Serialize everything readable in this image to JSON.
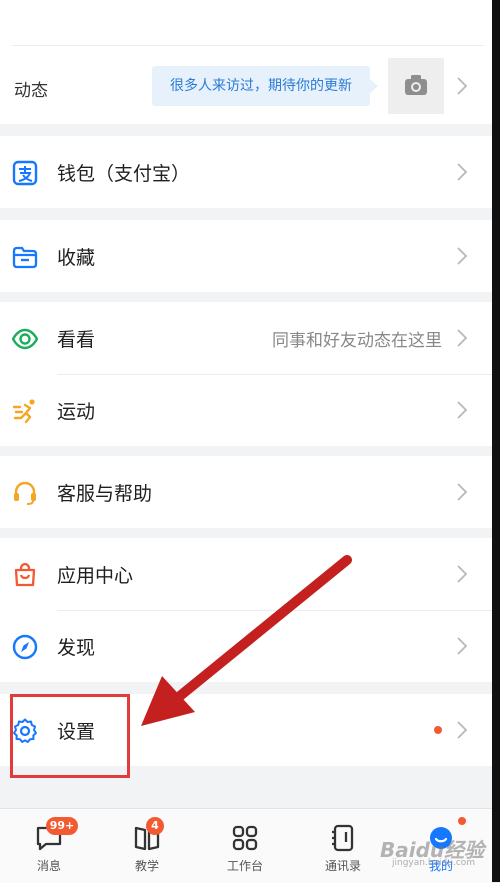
{
  "moments": {
    "label": "动态",
    "bubble_text": "很多人来访过，期待你的更新"
  },
  "menu": {
    "wallet": "钱包（支付宝）",
    "favorites": "收藏",
    "watch": "看看",
    "watch_hint": "同事和好友动态在这里",
    "sports": "运动",
    "service": "客服与帮助",
    "apps": "应用中心",
    "discover": "发现",
    "settings": "设置"
  },
  "tabs": {
    "messages": "消息",
    "messages_badge": "99+",
    "teaching": "教学",
    "teaching_badge": "4",
    "workbench": "工作台",
    "contacts": "通讯录",
    "me": "我的"
  },
  "watermark": {
    "text": "Baidu经验",
    "sub": "jingyan.baidu.com"
  },
  "colors": {
    "accent_blue": "#2b7bd6",
    "badge_orange": "#f25a32",
    "annotation_red": "#e23b3b",
    "watch_green": "#1aad5b",
    "sports_orange": "#f5a623"
  }
}
